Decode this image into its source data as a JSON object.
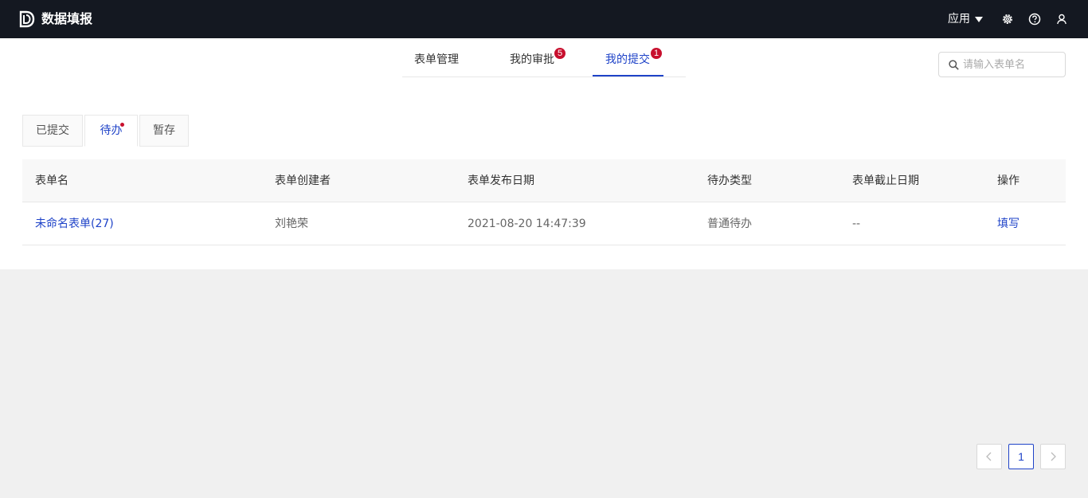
{
  "topbar": {
    "title": "数据填报",
    "apps_label": "应用",
    "icons": [
      "logo-icon",
      "settings-icon",
      "help-icon",
      "user-icon"
    ]
  },
  "nav": {
    "tabs": [
      {
        "label": "表单管理",
        "badge": ""
      },
      {
        "label": "我的审批",
        "badge": "5"
      },
      {
        "label": "我的提交",
        "badge": "1"
      }
    ],
    "active_tab": "我的提交"
  },
  "search": {
    "placeholder": "请输入表单名",
    "value": ""
  },
  "sub_tabs": {
    "items": [
      "已提交",
      "待办",
      "暂存"
    ],
    "active": "待办"
  },
  "table": {
    "columns": [
      "表单名",
      "表单创建者",
      "表单发布日期",
      "待办类型",
      "表单截止日期",
      "操作"
    ],
    "rows": [
      {
        "name": "未命名表单(27)",
        "creator": "刘艳荣",
        "publish_date": "2021-08-20 14:47:39",
        "todo_type": "普通待办",
        "deadline": "--",
        "action": "填写"
      }
    ]
  },
  "pagination": {
    "prev": "<",
    "current": "1",
    "next": ">"
  },
  "colors": {
    "topbar_bg": "#141821",
    "accent": "#1f43c8",
    "badge": "#c8102e",
    "page_bg": "#f0f0f0"
  }
}
